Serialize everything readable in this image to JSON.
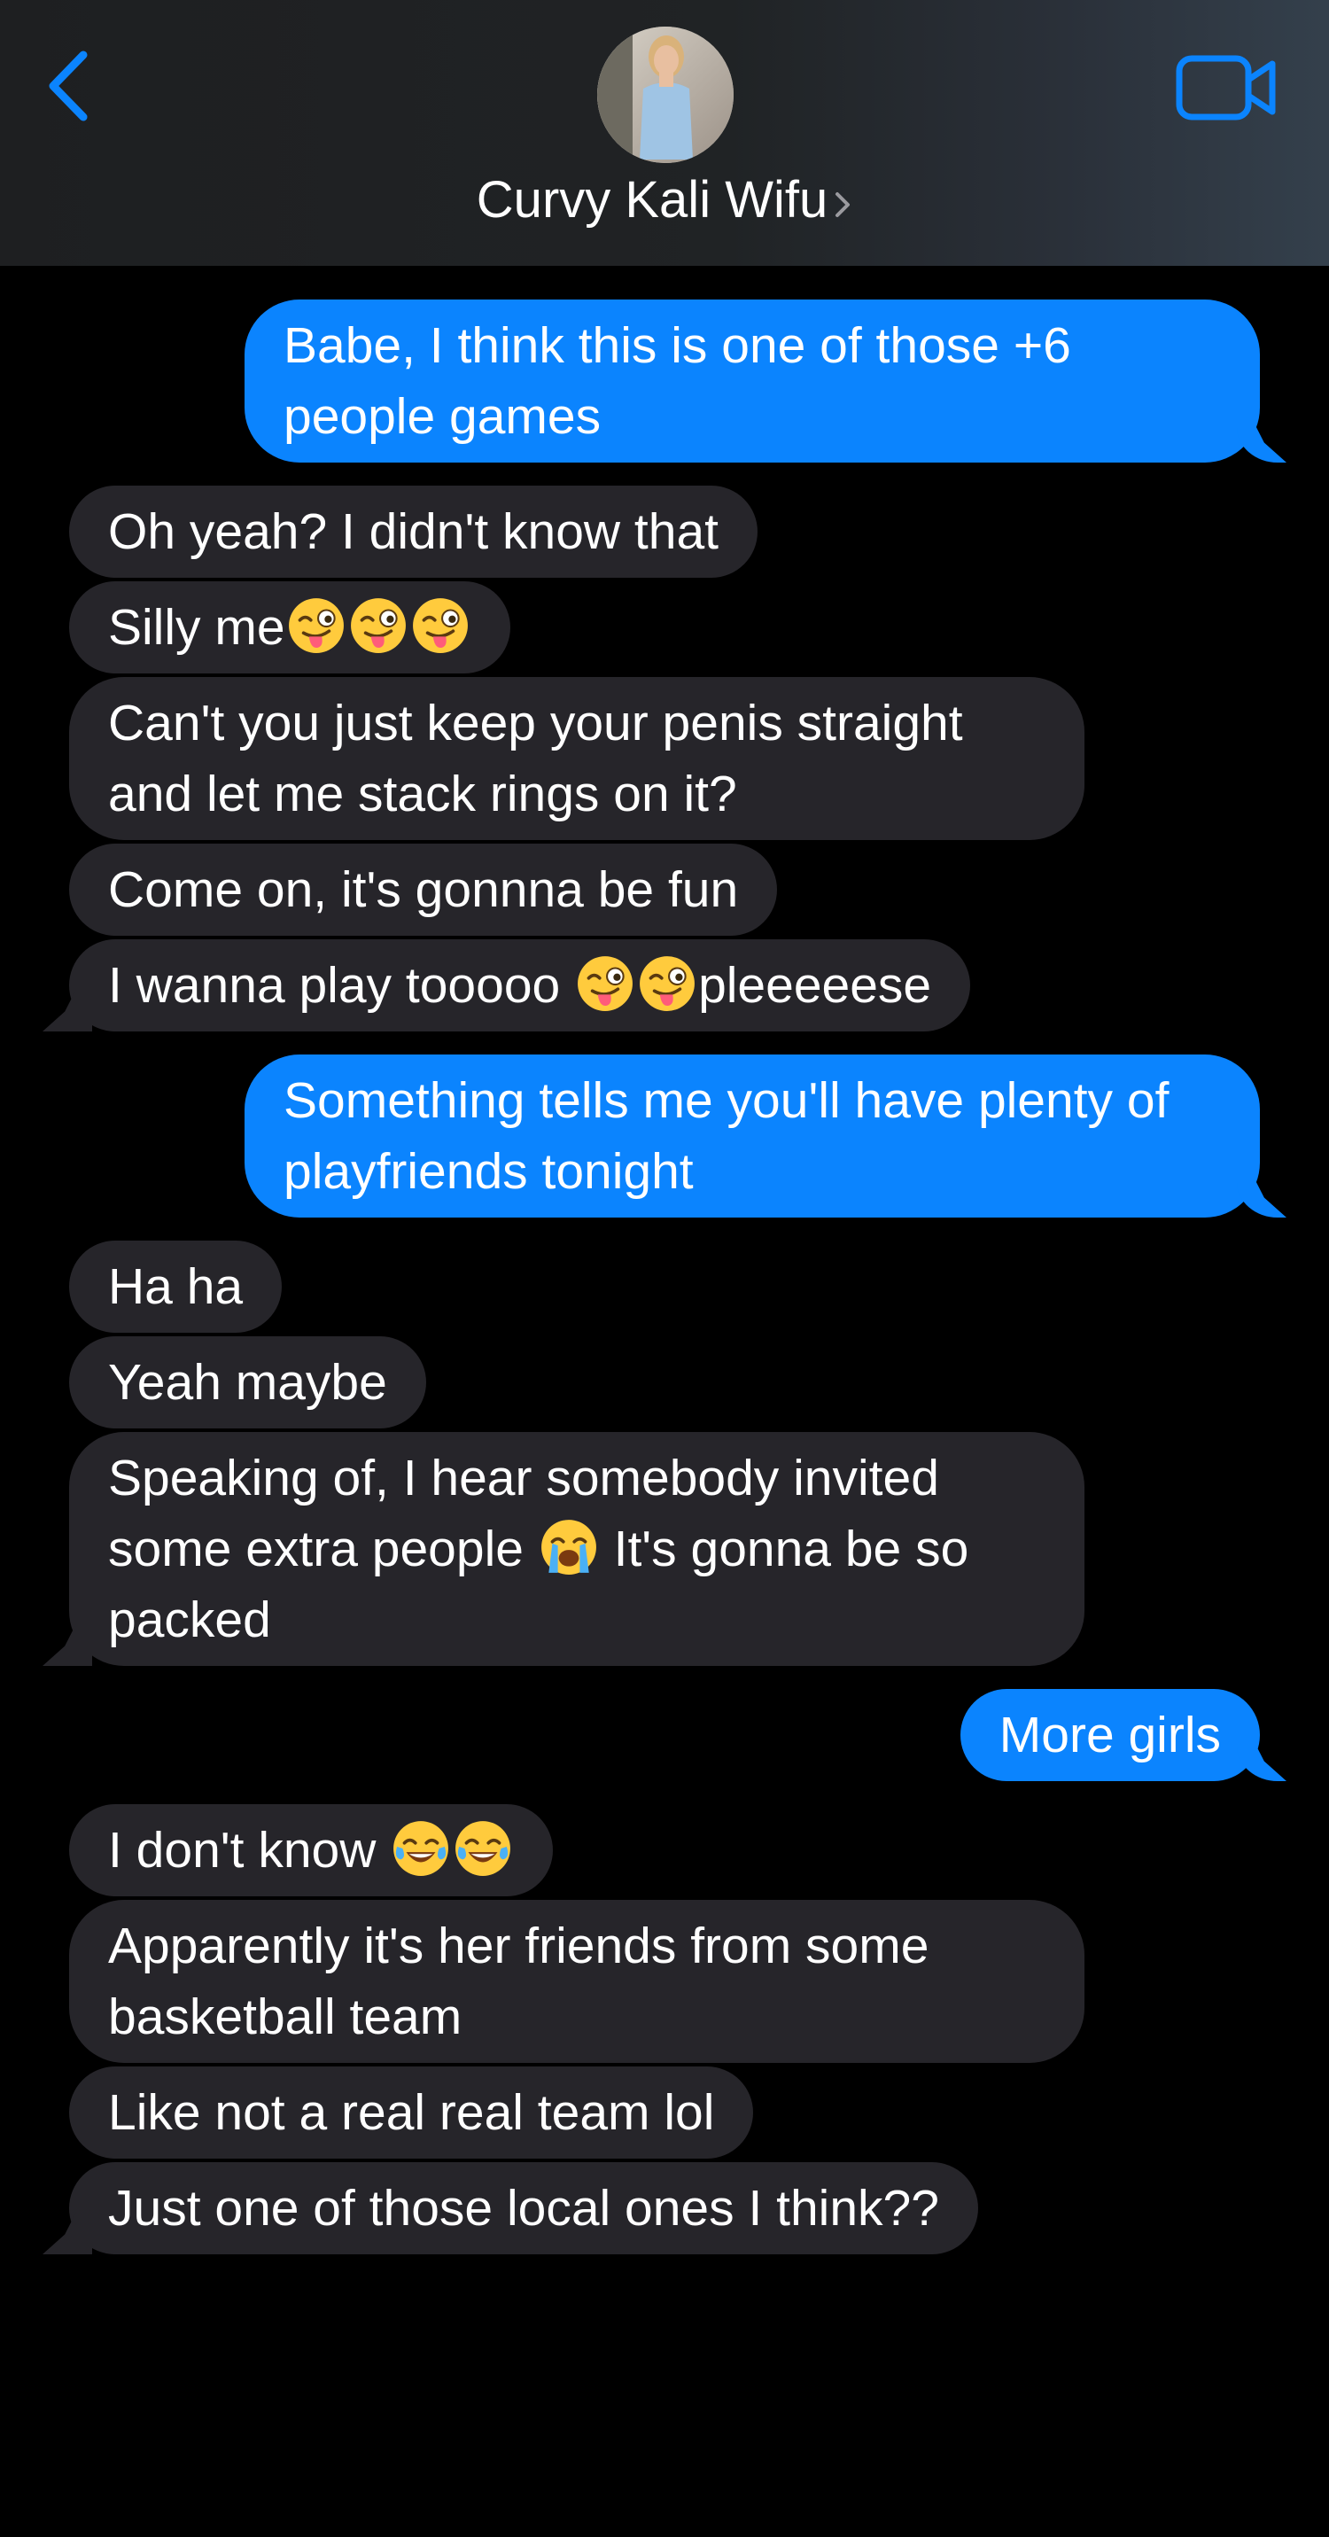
{
  "header": {
    "contact_name": "Curvy Kali Wifu",
    "back_icon": "chevron-left-icon",
    "video_icon": "video-camera-icon",
    "accent": "#0b84fe"
  },
  "colors": {
    "sent_bubble": "#0b84fe",
    "received_bubble": "#26252a",
    "background": "#000000"
  },
  "messages": [
    {
      "dir": "sent",
      "tail": true,
      "parts": [
        "Babe, I think this is one of those +6 people games"
      ]
    },
    {
      "dir": "recv",
      "tail": false,
      "parts": [
        "Oh yeah? I didn't know that"
      ]
    },
    {
      "dir": "recv",
      "tail": false,
      "parts": [
        "Silly me",
        ":wink-tongue:",
        ":wink-tongue:",
        ":wink-tongue:"
      ]
    },
    {
      "dir": "recv",
      "tail": false,
      "parts": [
        "Can't you just keep your penis straight and let me stack rings on it?"
      ]
    },
    {
      "dir": "recv",
      "tail": false,
      "parts": [
        "Come on, it's gonnna be fun"
      ]
    },
    {
      "dir": "recv",
      "tail": true,
      "parts": [
        "I wanna play tooooo ",
        ":wink-tongue:",
        ":wink-tongue:",
        "pleeeeese"
      ]
    },
    {
      "dir": "sent",
      "tail": true,
      "parts": [
        "Something tells me you'll have plenty of playfriends tonight"
      ]
    },
    {
      "dir": "recv",
      "tail": false,
      "parts": [
        "Ha ha"
      ]
    },
    {
      "dir": "recv",
      "tail": false,
      "parts": [
        "Yeah maybe"
      ]
    },
    {
      "dir": "recv",
      "tail": true,
      "parts": [
        "Speaking of, I hear somebody invited some extra people ",
        ":crying:",
        " It's gonna be so packed"
      ]
    },
    {
      "dir": "sent",
      "tail": true,
      "parts": [
        "More girls"
      ]
    },
    {
      "dir": "recv",
      "tail": false,
      "parts": [
        "I don't know ",
        ":tears-of-joy:",
        ":tears-of-joy:"
      ]
    },
    {
      "dir": "recv",
      "tail": false,
      "parts": [
        "Apparently it's her friends from some basketball team"
      ]
    },
    {
      "dir": "recv",
      "tail": false,
      "parts": [
        "Like not a real real team lol"
      ]
    },
    {
      "dir": "recv",
      "tail": true,
      "parts": [
        "Just one of those local ones I think??"
      ]
    }
  ]
}
